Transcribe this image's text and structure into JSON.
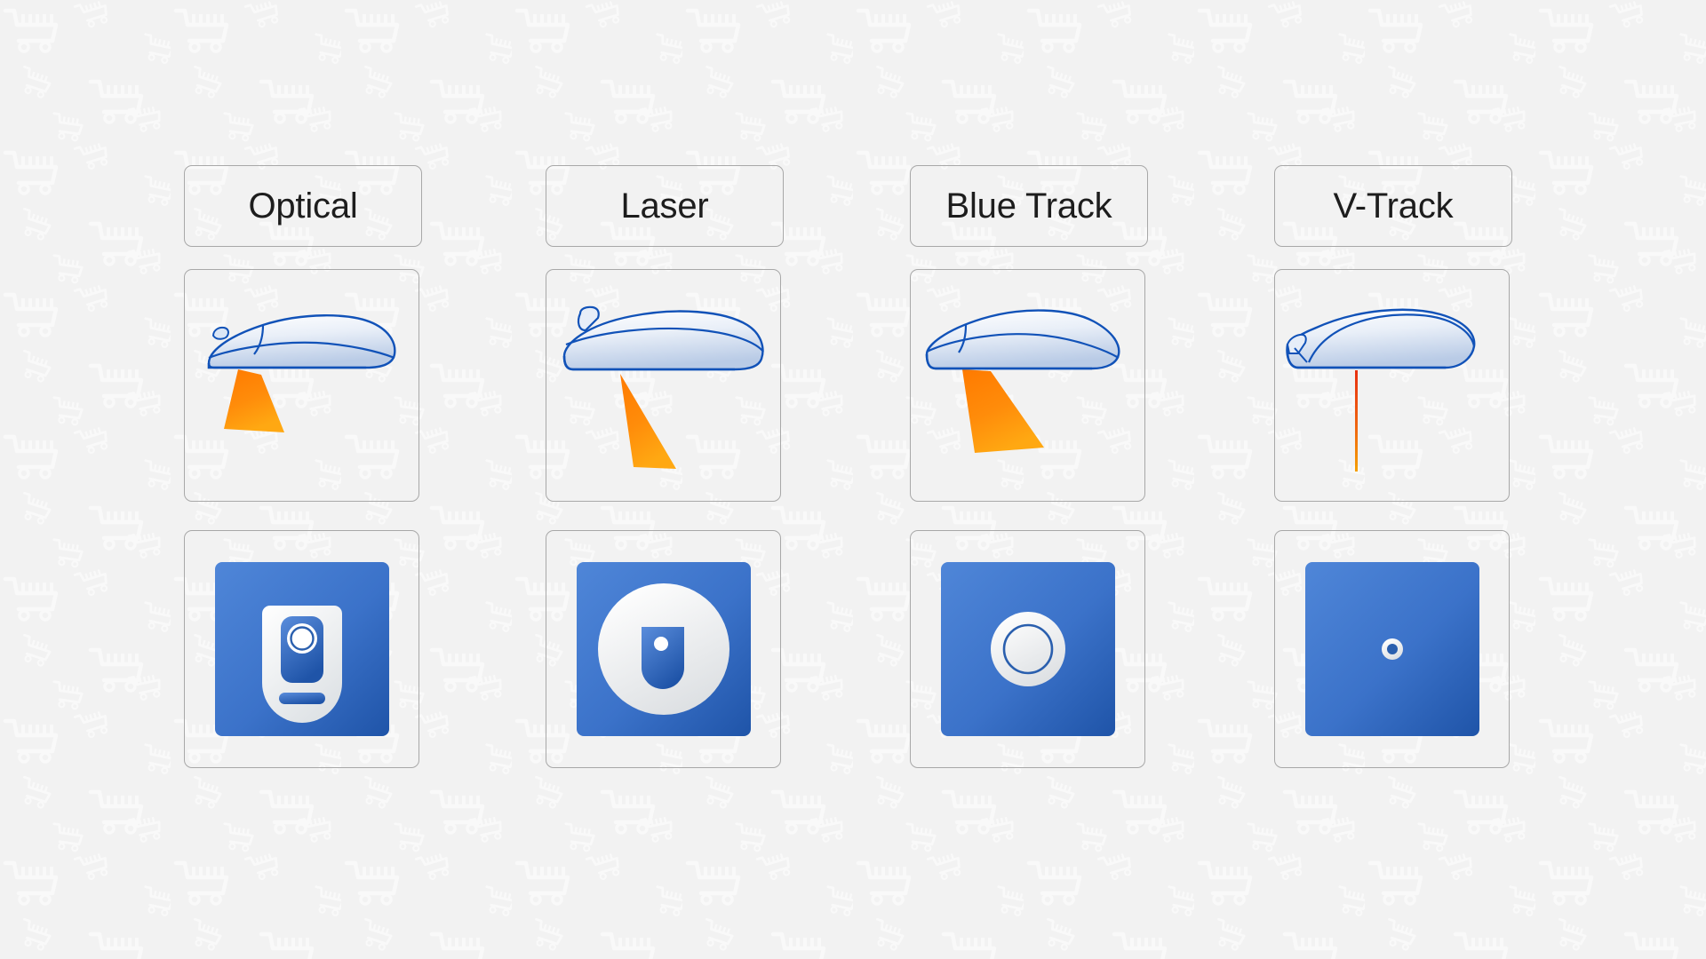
{
  "page": {
    "background_color": "#f2f2f2",
    "watermark_icon": "shopping-cart-icon",
    "watermark_color": "#ffffff",
    "card_border_color": "#a8a8a8",
    "accent_blue": "#3a6fc4",
    "outline_blue": "#1152b8",
    "beam_orange": "#ff8a00",
    "beam_orange_dark": "#f57c00",
    "vtrack_line_top": "#e83010",
    "vtrack_line_bottom": "#f5a000",
    "label_text_color": "#1d1d1d"
  },
  "columns": [
    {
      "id": "optical",
      "label": "Optical",
      "illustration_name": "optical-mouse-beam-illustration",
      "beam_type": "wide-cone",
      "sensor_icon_name": "optical-sensor-icon"
    },
    {
      "id": "laser",
      "label": "Laser",
      "illustration_name": "laser-mouse-beam-illustration",
      "beam_type": "narrow-cone",
      "sensor_icon_name": "laser-sensor-icon"
    },
    {
      "id": "blue-track",
      "label": "Blue Track",
      "illustration_name": "blue-track-mouse-beam-illustration",
      "beam_type": "wide-cone",
      "sensor_icon_name": "blue-track-sensor-icon"
    },
    {
      "id": "v-track",
      "label": "V-Track",
      "illustration_name": "v-track-mouse-beam-illustration",
      "beam_type": "thin-line",
      "sensor_icon_name": "v-track-sensor-icon"
    }
  ]
}
